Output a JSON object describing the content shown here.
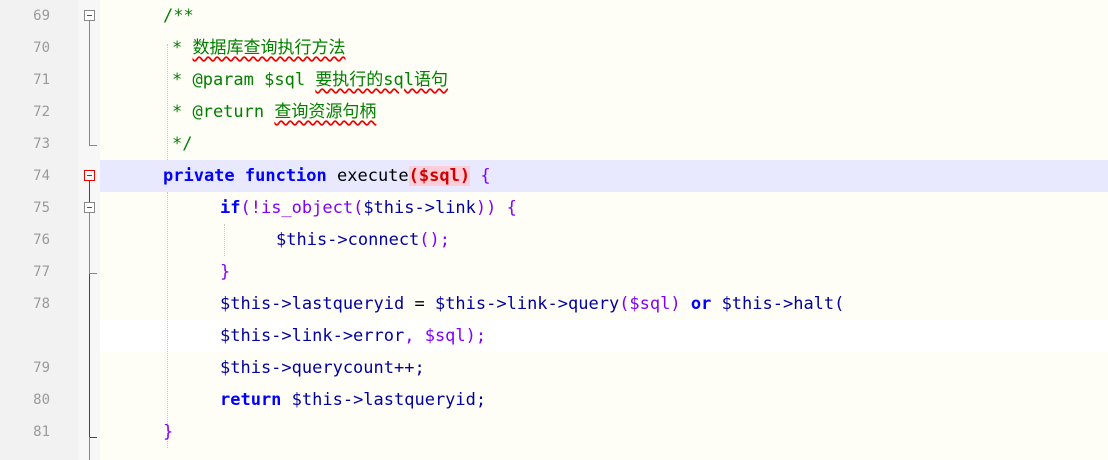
{
  "editor": {
    "line_numbers": [
      "69",
      "70",
      "71",
      "72",
      "73",
      "74",
      "75",
      "76",
      "77",
      "78",
      "79",
      "80",
      "81"
    ],
    "lines": {
      "l69": "/**",
      "l70_star": "* ",
      "l70_text": "数据库查询执行方法",
      "l71_a": "* @param $sql ",
      "l71_b": "要执行的sql语句",
      "l72_a": "* @return ",
      "l72_b": "查询资源句柄",
      "l73": "*/",
      "l74_kw": "private function",
      "l74_name": " execute",
      "l74_paren": "($sql)",
      "l74_brace": " {",
      "l75_if": "if",
      "l75_rest": "(!is_object(",
      "l75_var": "$this->link",
      "l75_end": ")) {",
      "l76_var": "$this->connect",
      "l76_end": "();",
      "l77": "}",
      "l78_a": "$this->lastqueryid",
      "l78_b": " = ",
      "l78_c": "$this->link->query",
      "l78_d": "($sql)",
      "l78_or": " or ",
      "l78_e": "$this->halt(",
      "l78w_a": "$this->link->error",
      "l78w_b": ", $sql);",
      "l79_var": "$this->querycount++;",
      "l80_kw": "return",
      "l80_var": " $this->lastqueryid;",
      "l81": "}"
    }
  },
  "colors": {
    "keyword": "#0000ff",
    "comment": "#008000",
    "current_line": "#e8e8ff",
    "fold_marker_active": "#e00000",
    "background": "#fffef6"
  }
}
